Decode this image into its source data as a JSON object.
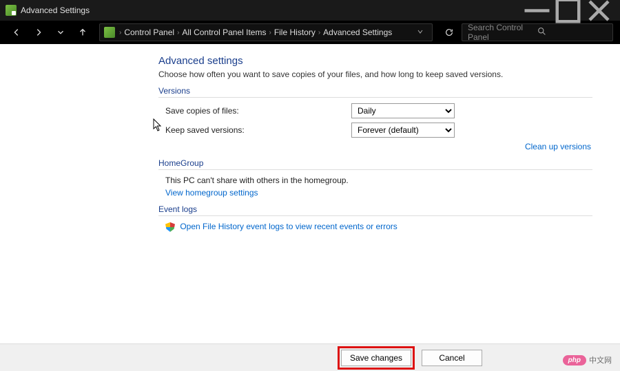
{
  "window": {
    "title": "Advanced Settings"
  },
  "breadcrumb": {
    "item1": "Control Panel",
    "item2": "All Control Panel Items",
    "item3": "File History",
    "item4": "Advanced Settings"
  },
  "search": {
    "placeholder": "Search Control Panel"
  },
  "main": {
    "heading": "Advanced settings",
    "description": "Choose how often you want to save copies of your files, and how long to keep saved versions.",
    "sections": {
      "versions": {
        "title": "Versions",
        "save_copies_label": "Save copies of files:",
        "save_copies_value": "Daily",
        "keep_versions_label": "Keep saved versions:",
        "keep_versions_value": "Forever (default)",
        "cleanup_link": "Clean up versions"
      },
      "homegroup": {
        "title": "HomeGroup",
        "text": "This PC can't share with others in the homegroup.",
        "link": "View homegroup settings"
      },
      "eventlogs": {
        "title": "Event logs",
        "link": "Open File History event logs to view recent events or errors"
      }
    }
  },
  "footer": {
    "save": "Save changes",
    "cancel": "Cancel"
  },
  "watermark": {
    "badge": "php",
    "text": "中文网"
  }
}
